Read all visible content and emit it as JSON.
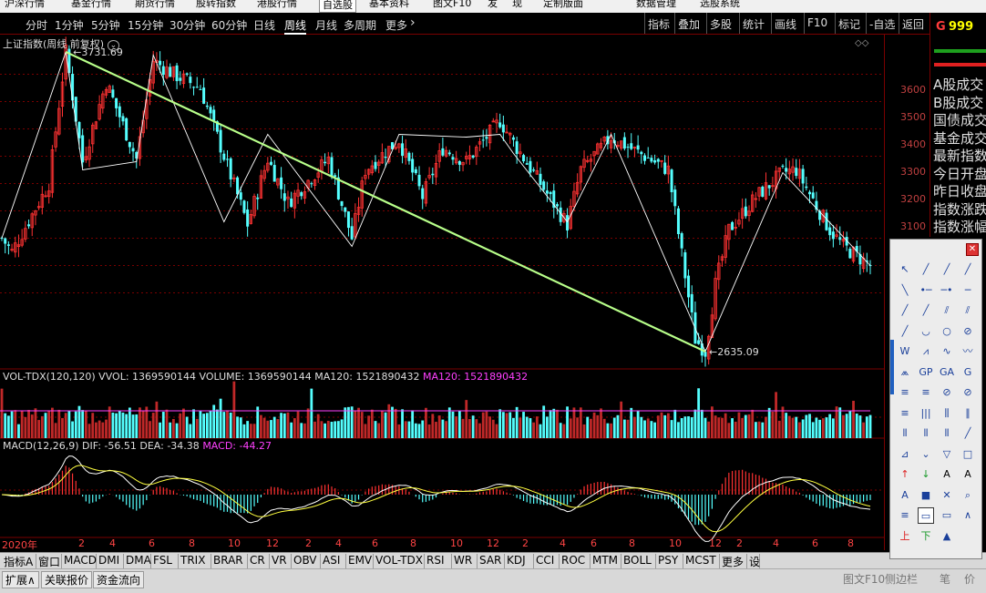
{
  "menu": [
    "沪深行情",
    "基金行情",
    "期货行情",
    "股转指数",
    "港股行情",
    "自选股",
    "基本资料",
    "图文F10",
    "发",
    "现",
    "定制版面",
    "数据管理",
    "选股系统"
  ],
  "periods": [
    "分时",
    "1分钟",
    "5分钟",
    "15分钟",
    "30分钟",
    "60分钟",
    "日线",
    "周线",
    "月线",
    "多周期",
    "更多"
  ],
  "active_period": "周线",
  "toolbar": [
    "指标",
    "叠加",
    "多股",
    "统计",
    "画线",
    "F10",
    "标记",
    "-自选",
    "返回"
  ],
  "right_info": {
    "code_prefix": "G",
    "code": "999",
    "items": [
      "A股成交",
      "B股成交",
      "国债成交",
      "基金成交",
      "最新指数",
      "今日开盘",
      "昨日收盘",
      "指数涨跌",
      "指数涨幅"
    ]
  },
  "main_label": "上证指数(周线 前复权)",
  "high_label": "3731.69",
  "low_label": "2635.09",
  "price_ticks": [
    "3600",
    "3500",
    "3400",
    "3300",
    "3200",
    "3100"
  ],
  "vol_label": {
    "prefix": "VOL-TDX(120,120) VVOL: 1369590144 VOLUME: 1369590144 MA120: 1521890432",
    "ma": "MA120: 1521890432"
  },
  "macd_label": {
    "prefix": "MACD(12,26,9) DIF: -56.51 DEA: -34.38",
    "macd": "MACD: -44.27"
  },
  "dates": [
    "2020年",
    "2",
    "4",
    "6",
    "8",
    "10",
    "12",
    "2",
    "4",
    "6",
    "8",
    "10",
    "12",
    "2",
    "4",
    "6",
    "8",
    "10",
    "12",
    "2",
    "4",
    "6",
    "8"
  ],
  "tabs": [
    "指标A",
    "窗口",
    "MACD",
    "DMI",
    "DMA",
    "FSL",
    "TRIX",
    "BRAR",
    "CR",
    "VR",
    "OBV",
    "ASI",
    "EMV",
    "VOL-TDX",
    "RSI",
    "WR",
    "SAR",
    "KDJ",
    "CCI",
    "ROC",
    "MTM",
    "BOLL",
    "PSY",
    "MCST",
    "更多",
    "设"
  ],
  "bottom": [
    "扩展∧",
    "关联报价",
    "资金流向"
  ],
  "bottom_right": [
    "图文F10",
    "侧边栏",
    "笔",
    "价"
  ],
  "tools": [
    "↖",
    "╱",
    "╱",
    "╱",
    "╲",
    "•─",
    "─•",
    "─",
    "╱",
    "╱",
    "⫽",
    "⫽",
    "╱",
    "◡",
    "○",
    "⊘",
    "W",
    "⩘",
    "∿",
    "〰",
    "⩕",
    "GP",
    "GA",
    "G",
    "≡",
    "≡",
    "⊘",
    "⊘",
    "≡",
    "|||",
    "⫼",
    "∥",
    "⦀",
    "⦀",
    "⦀",
    "╱",
    "⊿",
    "⌄",
    "▽",
    "□",
    "↑",
    "↓",
    "A",
    "A",
    "A",
    "■",
    "✕",
    "⌕",
    "≡",
    "▭",
    "▭",
    "∧",
    "上",
    "下",
    "▲"
  ],
  "colors": {
    "up": "#ff3232",
    "down": "#54ffff",
    "trend": "#b8ff8a",
    "zigzag": "#ffffff",
    "ma": "#ff40ff"
  }
}
